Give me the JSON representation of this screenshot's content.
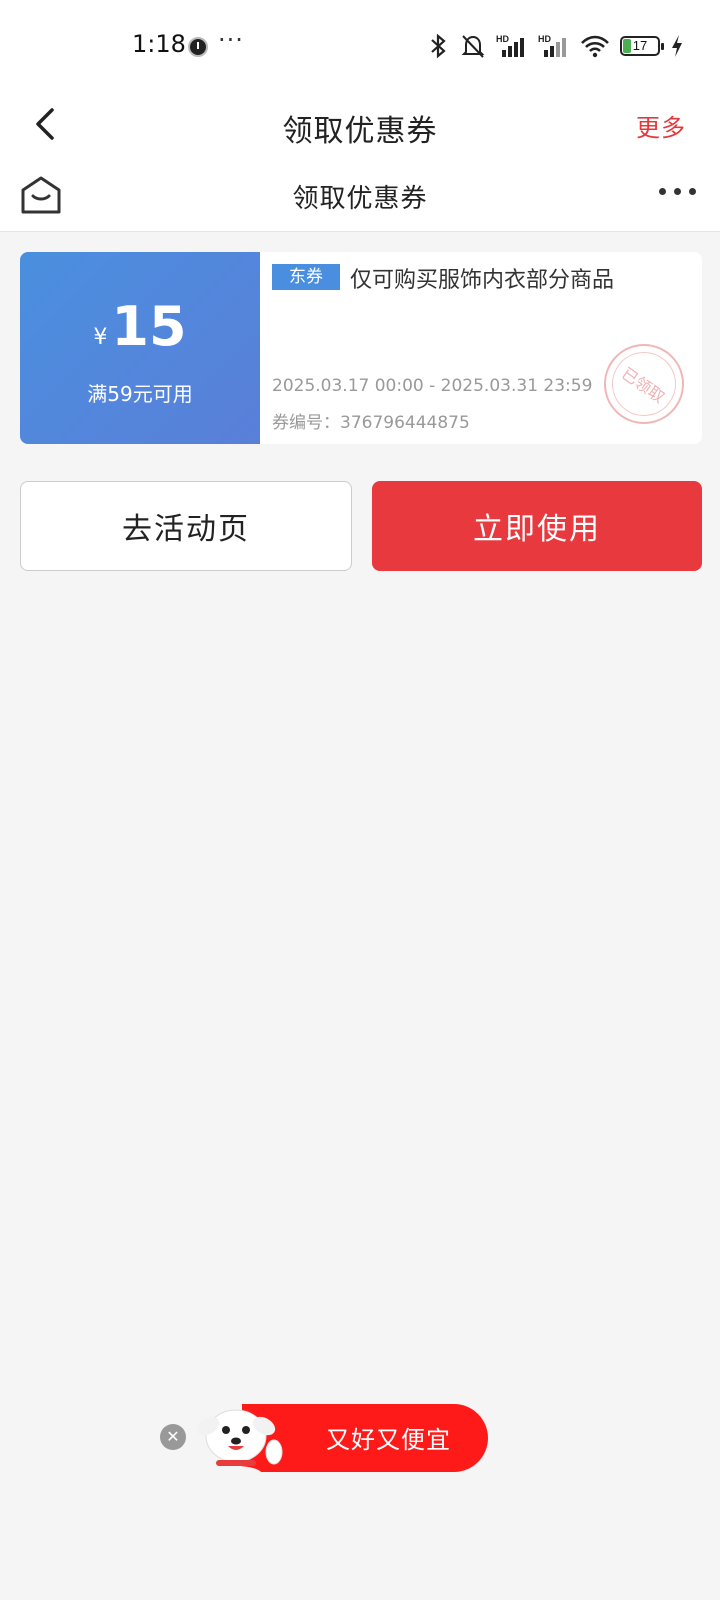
{
  "status_bar": {
    "time": "1:18",
    "more": "···",
    "battery_level": "17",
    "icons": [
      "bluetooth-icon",
      "mute-bell-icon",
      "signal-hd-icon",
      "signal-hd-icon",
      "wifi-icon",
      "battery-icon",
      "charging-icon"
    ]
  },
  "header": {
    "title": "领取优惠券",
    "more_label": "更多"
  },
  "subheader": {
    "title": "领取优惠券"
  },
  "coupon": {
    "currency": "¥",
    "amount": "15",
    "threshold": "满59元可用",
    "tag": "东券",
    "description": "仅可购买服饰内衣部分商品",
    "validity": "2025.03.17 00:00 - 2025.03.31 23:59",
    "code_label": "券编号：",
    "code": "376796444875",
    "stamp": "已领取",
    "accent_color": "#4a8fdf"
  },
  "actions": {
    "activity_label": "去活动页",
    "use_label": "立即使用",
    "use_color": "#e8393f"
  },
  "float_banner": {
    "close": "✕",
    "text": "又好又便宜"
  }
}
